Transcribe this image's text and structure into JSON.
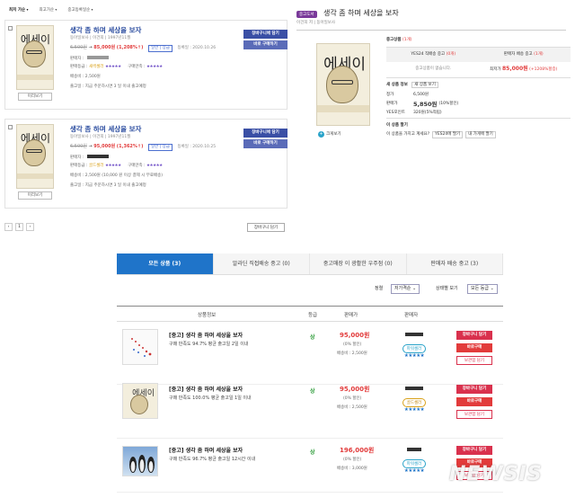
{
  "sort_bar": {
    "items": [
      "최저 가순",
      "최고가순",
      "중고등록일순"
    ]
  },
  "listings": [
    {
      "title": "생각 좀 하며 세상을 보자",
      "publisher": "동아일보사 | 이건희 | 1997년11월",
      "orig_price": "6,500원",
      "sale_price": "85,000원",
      "rate": "(1,208%↑)",
      "ship_tag": "일반 | 상급",
      "reg_date": "등록일 : 2020.10.26",
      "seller_label": "판매자 :",
      "sat_label": "판매등급 :",
      "grade": "새싹셀러",
      "seller_stars": "★★★★★",
      "buyer_label": "구매만족 :",
      "buyer_stars": "★★★★★",
      "ship_fee": "배송비 : 2,500원",
      "ship_note": "출고일 : 지금 주문하시면 3 일 이내 출고예정",
      "cart_btn": "장바구니에 담기",
      "buy_btn": "바로 구매하기",
      "preview": "미리보기"
    },
    {
      "title": "생각 좀 하며 세상을 보자",
      "publisher": "동아일보사 | 이건희 | 1997년11월",
      "orig_price": "6,500원",
      "sale_price": "95,000원",
      "rate": "(1,362%↑)",
      "ship_tag": "일반 | 상급",
      "reg_date": "등록일 : 2020.10.25",
      "seller_label": "판매자 :",
      "sat_label": "판매등급 :",
      "grade": "골드셀러",
      "seller_stars": "★★★★★",
      "buyer_label": "구매만족 :",
      "buyer_stars": "★★★★★",
      "ship_fee": "배송비 : 2,500원 (10,000 원 이상 결제 시 무료배송)",
      "ship_note": "출고일 : 지금 주문하시면 3 일 이내 출고예정",
      "cart_btn": "장바구니에 담기",
      "buy_btn": "바로 구매하기",
      "preview": "미리보기"
    }
  ],
  "pager": {
    "prev": "‹",
    "page": "1",
    "next": "›"
  },
  "cart_all": "장바구니 담기",
  "right_panel": {
    "badge": "중고도서",
    "title": "생각 좀 하며 세상을 보자",
    "sub": "이건희 저 | 동아일보사",
    "zoom": "크게보기",
    "used_head": "중고상품",
    "used_count": "(1개)",
    "col_a": "YES24 직배송 중고",
    "col_a_n": "(0개)",
    "col_b": "판매자 배송 중고",
    "col_b_n": "(1개)",
    "none_text": "중고상품이 없습니다.",
    "lowest_label": "최저가",
    "lowest_price": "85,000원",
    "lowest_rate": "(+1208%할증)",
    "new_head": "새 상품 정보",
    "new_tag": "새 상품 보기",
    "list_price_label": "정가",
    "list_price": "6,500원",
    "sale_label": "판매가",
    "sale_price": "5,850원",
    "sale_rate": "(10%할인)",
    "point_label": "YES포인트",
    "point": "320원(5%적립)",
    "reg_head": "이 상품 팔기",
    "reg_text": "이 상품을 가지고 계세요?",
    "reg_btn1": "YES24에 팔기",
    "reg_btn2": "내 가게에 팔기"
  },
  "tabs": [
    {
      "label": "모든 상품 (3)"
    },
    {
      "label": "알라딘 직접배송 중고 (0)"
    },
    {
      "label": "중고매장 이 광활한 우주점 (0)"
    },
    {
      "label": "판매자 배송 중고 (3)"
    }
  ],
  "filter": {
    "sort_label": "정렬",
    "sort_value": "저가격순",
    "status_label": "상태별 보기",
    "status_value": "모든 등급"
  },
  "table_head": {
    "info": "상품정보",
    "grade": "등급",
    "price": "판매가",
    "seller": "판매자"
  },
  "products": [
    {
      "name": "[중고] 생각 좀 하며 세상을 보자",
      "meta": "구매 만족도 94.7%    평균 출고일 2일 이내",
      "grade": "상",
      "price": "95,000원",
      "disc": "(0% 할인)",
      "ship": "배송비 : 2,500원",
      "seller_label": "파워셀러",
      "seller_stars": "★★★★★",
      "btn_cart": "장바구니 담기",
      "btn_buy": "바로구매",
      "btn_keep": "보관함 담기"
    },
    {
      "name": "[중고] 생각 좀 하며 세상을 보자",
      "meta": "구매 만족도 100.0%    평균 출고일 1일 이내",
      "grade": "상",
      "price": "95,000원",
      "disc": "(0% 할인)",
      "ship": "배송비 : 2,500원",
      "seller_label": "골드셀러",
      "seller_stars": "★★★★★",
      "btn_cart": "장바구니 담기",
      "btn_buy": "바로구매",
      "btn_keep": "보관함 담기"
    },
    {
      "name": "[중고] 생각 좀 하며 세상을 보자",
      "meta": "구매 만족도 96.7%    평균 출고일 12시간 이내",
      "grade": "상",
      "price": "196,000원",
      "disc": "(0% 할인)",
      "ship": "배송비 : 3,000원",
      "seller_label": "파워셀러",
      "seller_stars": "★★★★★",
      "btn_cart": "장바구니 담기",
      "btn_buy": "바로구매",
      "btn_keep": "보관함 담기"
    }
  ],
  "watermark": "NEWSIS",
  "colors": {
    "accent_blue": "#1f74c9",
    "price_red": "#e23b3b",
    "cart_navy": "#3a4fa5",
    "badge_purple": "#7a3a9a"
  }
}
